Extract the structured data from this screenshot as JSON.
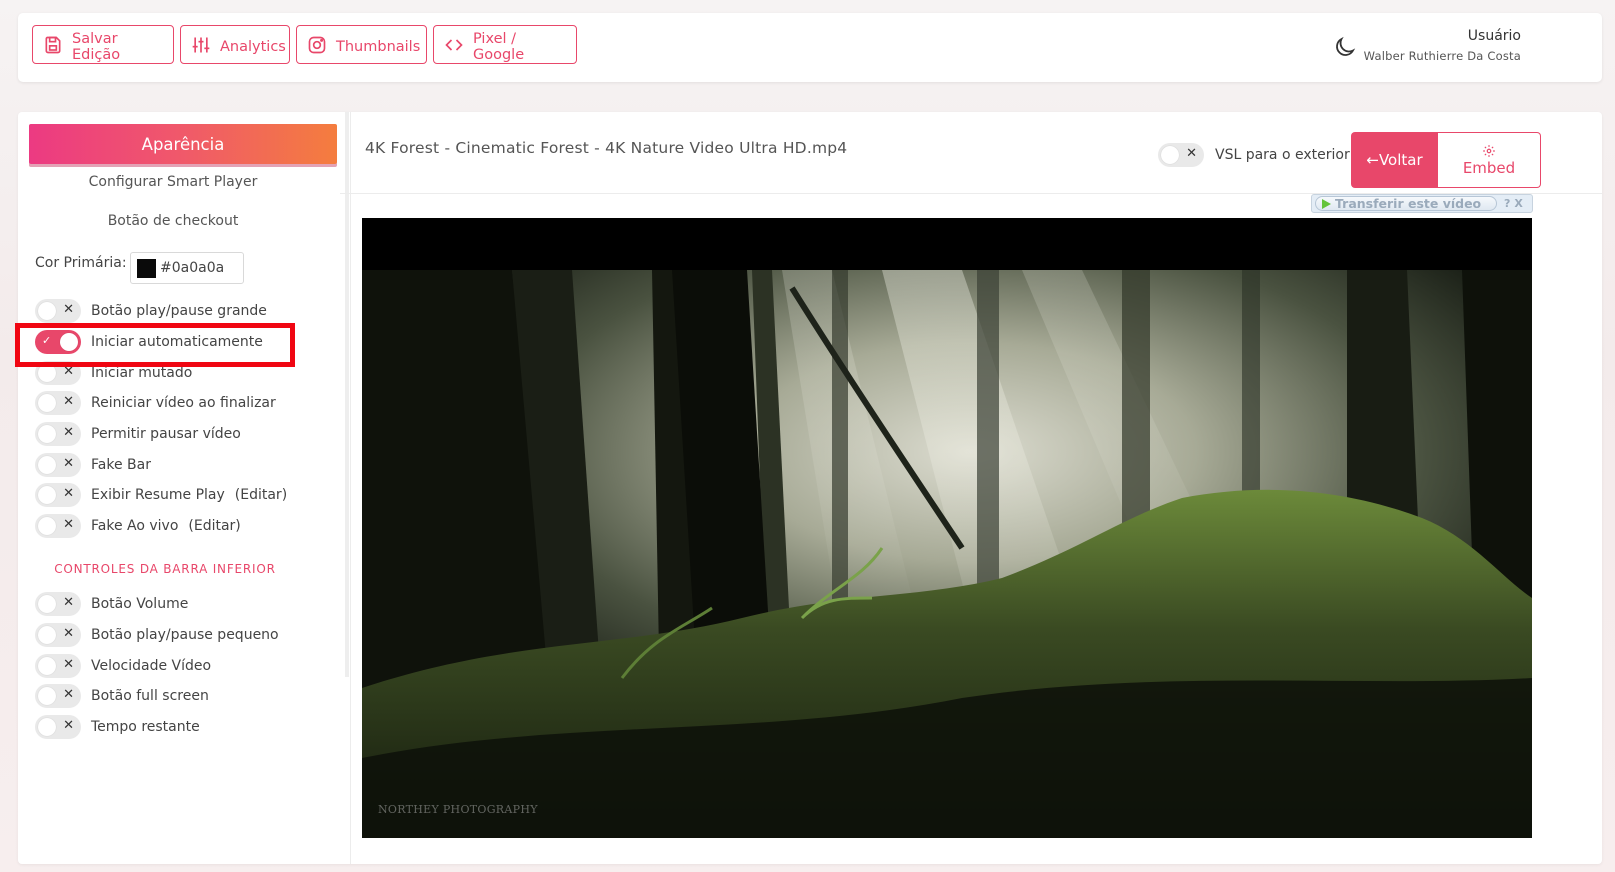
{
  "toolbar": {
    "salvar": "Salvar Edição",
    "analytics": "Analytics",
    "thumbnails": "Thumbnails",
    "pixel": "Pixel / Google"
  },
  "user": {
    "title": "Usuário",
    "name": "Walber Ruthierre Da Costa"
  },
  "sidebar": {
    "header": "Aparência",
    "links": [
      "Configurar Smart Player",
      "Botão de checkout"
    ],
    "cor_label": "Cor Primária:",
    "cor_value": "#0a0a0a",
    "toggles": [
      {
        "label": "Botão play/pause grande",
        "on": false
      },
      {
        "label": "Iniciar automaticamente",
        "on": true
      },
      {
        "label": "Iniciar mutado",
        "on": false
      },
      {
        "label": "Reiniciar vídeo ao finalizar",
        "on": false
      },
      {
        "label": "Permitir pausar vídeo",
        "on": false
      },
      {
        "label": "Fake Bar",
        "on": false
      },
      {
        "label": "Exibir Resume Play",
        "on": false,
        "edit": "(Editar)"
      },
      {
        "label": "Fake Ao vivo",
        "on": false,
        "edit": "(Editar)"
      }
    ],
    "section_title": "CONTROLES DA BARRA INFERIOR",
    "bottom_toggles": [
      {
        "label": "Botão Volume",
        "on": false
      },
      {
        "label": "Botão play/pause pequeno",
        "on": false
      },
      {
        "label": "Velocidade Vídeo",
        "on": false
      },
      {
        "label": "Botão full screen",
        "on": false
      },
      {
        "label": "Tempo restante",
        "on": false
      }
    ]
  },
  "content": {
    "video_title": "4K Forest - Cinematic Forest - 4K Nature Video Ultra HD.mp4",
    "vsl_label": "VSL para o exterior",
    "voltar": "←Voltar",
    "embed": "Embed",
    "download_label": "Transferir este vídeo",
    "download_help": "?",
    "download_close": "X",
    "watermark": "NORTHEY PHOTOGRAPHY"
  },
  "colors": {
    "accent": "#e8476a",
    "highlight": "#f00612",
    "gradient_start": "#ec3a82",
    "gradient_end": "#f47d3e"
  },
  "icons": {
    "salvar": "save-icon",
    "analytics": "sliders-icon",
    "thumbnails": "instagram-icon",
    "pixel": "code-icon",
    "theme": "moon-icon",
    "embed": "gear-icon"
  }
}
